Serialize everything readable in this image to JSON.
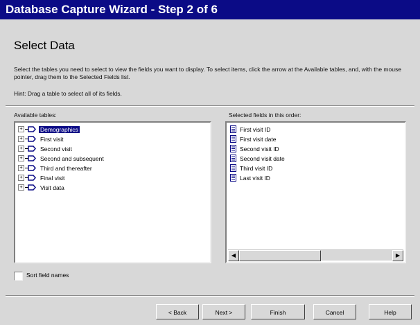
{
  "window": {
    "title": "Database Capture Wizard - Step 2 of 6"
  },
  "page": {
    "heading": "Select Data",
    "description": "Select the tables you need to select to view the fields you want to display. To select items, click the arrow at the Available tables, and, with the mouse pointer, drag them to the Selected Fields list.",
    "hint": "Hint: Drag a table to select all of its fields."
  },
  "available_tables": {
    "label": "Available tables:",
    "items": [
      {
        "label": "Demographics",
        "selected": true
      },
      {
        "label": "First visit",
        "selected": false
      },
      {
        "label": "Second visit",
        "selected": false
      },
      {
        "label": "Second and subsequent",
        "selected": false
      },
      {
        "label": "Third and thereafter",
        "selected": false
      },
      {
        "label": "Final visit",
        "selected": false
      },
      {
        "label": "Visit data",
        "selected": false
      }
    ]
  },
  "selected_fields": {
    "label": "Selected fields in this order:",
    "items": [
      {
        "label": "First visit ID"
      },
      {
        "label": "First visit date"
      },
      {
        "label": "Second visit ID"
      },
      {
        "label": "Second visit date"
      },
      {
        "label": "Third visit ID"
      },
      {
        "label": "Last visit ID"
      }
    ]
  },
  "options": {
    "sort_field_names": "Sort field names"
  },
  "buttons": {
    "back": "< Back",
    "next": "Next >",
    "finish": "Finish",
    "cancel": "Cancel",
    "help": "Help"
  },
  "colors": {
    "title_bar": "#0b0b86",
    "dialog_face": "#d8d8d8",
    "selection": "#0b0b86"
  }
}
